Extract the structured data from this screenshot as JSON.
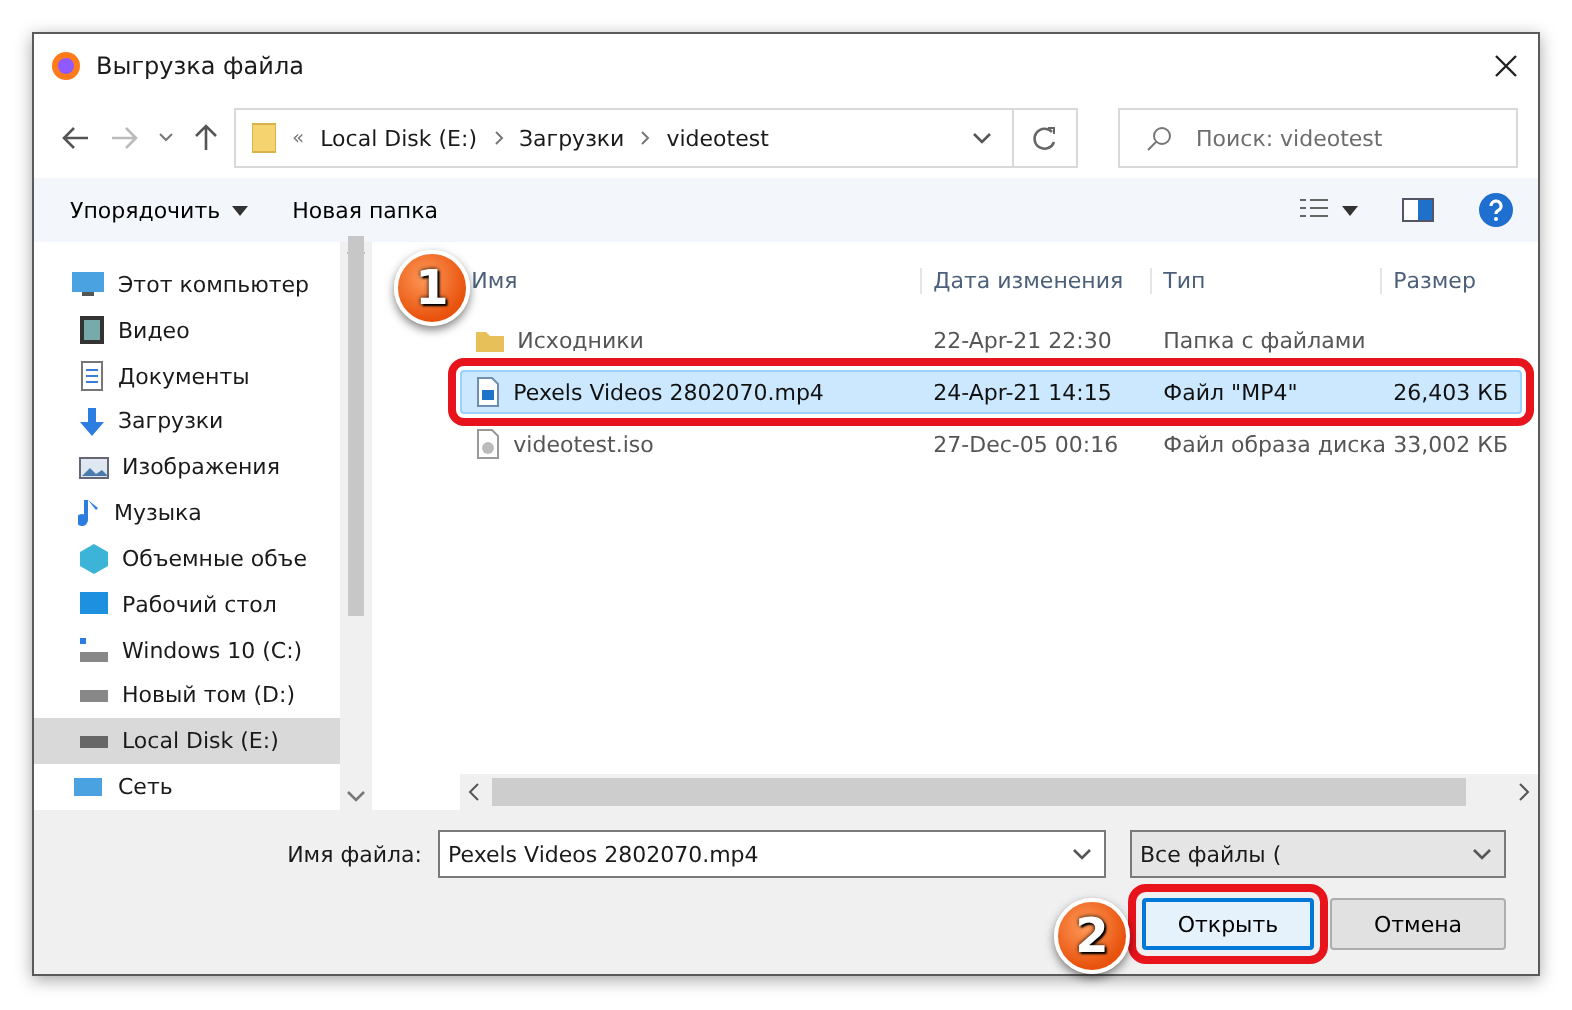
{
  "window": {
    "title": "Выгрузка файла"
  },
  "address": {
    "overflow": "«",
    "crumbs": [
      "Local Disk (E:)",
      "Загрузки",
      "videotest"
    ]
  },
  "search": {
    "placeholder": "Поиск: videotest"
  },
  "toolbar": {
    "organize": "Упорядочить",
    "new_folder": "Новая папка"
  },
  "sidebar": {
    "items": [
      {
        "label": "Этот компьютер",
        "selected": false,
        "children": [
          {
            "label": "Видео",
            "selected": false
          },
          {
            "label": "Документы",
            "selected": false
          },
          {
            "label": "Загрузки",
            "selected": false
          },
          {
            "label": "Изображения",
            "selected": false
          },
          {
            "label": "Музыка",
            "selected": false
          },
          {
            "label": "Объемные объе",
            "selected": false
          },
          {
            "label": "Рабочий стол",
            "selected": false
          },
          {
            "label": "Windows 10 (C:)",
            "selected": false
          },
          {
            "label": "Новый том (D:)",
            "selected": false
          },
          {
            "label": "Local Disk (E:)",
            "selected": true
          }
        ]
      },
      {
        "label": "Сеть",
        "selected": false
      }
    ]
  },
  "table": {
    "columns": [
      "Имя",
      "Дата изменения",
      "Тип",
      "Размер"
    ],
    "rows": [
      {
        "kind": "folder",
        "selected": false,
        "highlighted": false,
        "cells": [
          "Исходники",
          "22-Apr-21 22:30",
          "Папка с файлами",
          ""
        ]
      },
      {
        "kind": "video",
        "selected": true,
        "highlighted": true,
        "cells": [
          "Pexels Videos 2802070.mp4",
          "24-Apr-21 14:15",
          "Файл \"MP4\"",
          "26,403 КБ"
        ]
      },
      {
        "kind": "disc",
        "selected": false,
        "highlighted": false,
        "cells": [
          "videotest.iso",
          "27-Dec-05 00:16",
          "Файл образа диска",
          "33,002 КБ"
        ]
      }
    ]
  },
  "filename": {
    "label": "Имя файла:",
    "value": "Pexels Videos 2802070.mp4"
  },
  "filetype": {
    "value": "Все файлы ("
  },
  "buttons": [
    {
      "label": "Открыть",
      "kind": "primary",
      "highlighted": true
    },
    {
      "label": "Отмена",
      "kind": "normal",
      "highlighted": false
    }
  ],
  "annotations": [
    "1",
    "2"
  ]
}
